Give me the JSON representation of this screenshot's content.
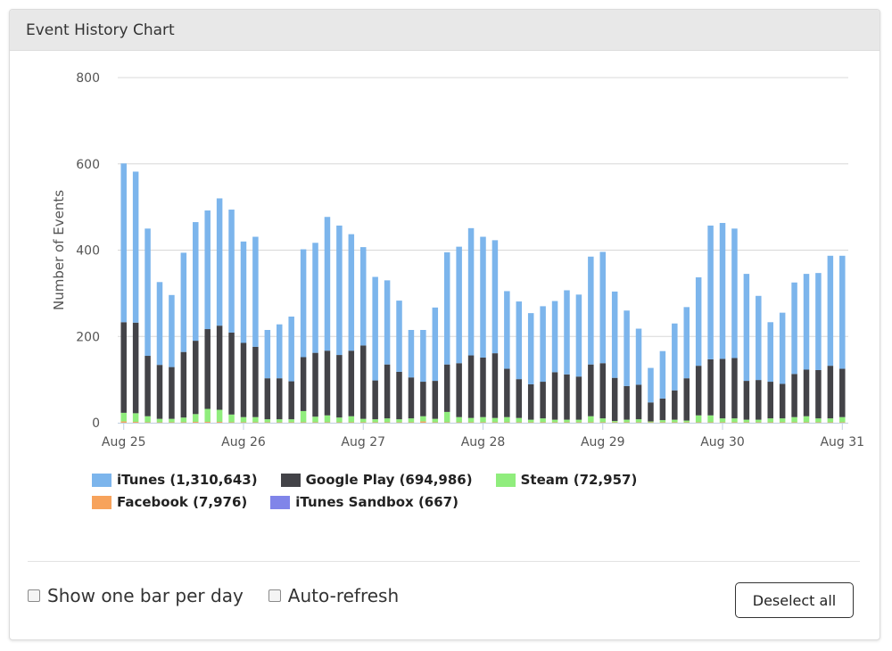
{
  "panel": {
    "title": "Event History Chart"
  },
  "chart_data": {
    "type": "bar",
    "stacked": true,
    "ylabel": "Number of Events",
    "ylim": [
      0,
      800
    ],
    "yticks": [
      0,
      200,
      400,
      600,
      800
    ],
    "xticks": [
      "Aug 25",
      "Aug 26",
      "Aug 27",
      "Aug 28",
      "Aug 29",
      "Aug 30",
      "Aug 31"
    ],
    "grid": true,
    "legend_position": "bottom",
    "series": [
      {
        "name": "iTunes (1,310,643)",
        "color": "#7cb5ec",
        "values": [
          368,
          350,
          295,
          192,
          167,
          230,
          275,
          275,
          295,
          285,
          235,
          255,
          112,
          125,
          150,
          250,
          255,
          310,
          300,
          270,
          228,
          240,
          195,
          165,
          110,
          120,
          170,
          260,
          270,
          295,
          280,
          262,
          180,
          180,
          165,
          175,
          165,
          195,
          190,
          250,
          258,
          200,
          175,
          130,
          80,
          110,
          155,
          165,
          205,
          310,
          315,
          300,
          248,
          195,
          138,
          165,
          212,
          222,
          225,
          255,
          262
        ],
        "hidden_layout_note": null
      },
      {
        "name": "Google Play (694,986)",
        "color": "#434348",
        "values": [
          210,
          210,
          140,
          125,
          120,
          152,
          170,
          185,
          195,
          190,
          172,
          163,
          95,
          95,
          88,
          125,
          148,
          150,
          145,
          152,
          170,
          90,
          125,
          110,
          95,
          80,
          88,
          110,
          125,
          145,
          138,
          150,
          112,
          90,
          82,
          85,
          110,
          105,
          100,
          120,
          128,
          100,
          78,
          80,
          44,
          50,
          68,
          98,
          115,
          130,
          138,
          140,
          90,
          92,
          85,
          80,
          100,
          108,
          112,
          122,
          112
        ]
      },
      {
        "name": "Steam (72,957)",
        "color": "#90ed7d",
        "values": [
          20,
          20,
          14,
          8,
          8,
          11,
          18,
          30,
          28,
          18,
          12,
          12,
          7,
          7,
          7,
          26,
          13,
          16,
          11,
          14,
          8,
          7,
          9,
          7,
          9,
          12,
          8,
          24,
          12,
          10,
          12,
          10,
          12,
          10,
          6,
          9,
          6,
          6,
          6,
          14,
          9,
          3,
          6,
          7,
          2,
          5,
          6,
          4,
          16,
          16,
          9,
          9,
          6,
          6,
          9,
          9,
          12,
          14,
          9,
          9,
          12
        ]
      },
      {
        "name": "Facebook (7,976)",
        "color": "#f7a35c",
        "values": [
          3,
          2,
          1,
          1,
          1,
          1,
          2,
          2,
          2,
          1,
          1,
          1,
          1,
          1,
          1,
          1,
          1,
          1,
          1,
          1,
          1,
          1,
          1,
          1,
          1,
          3,
          1,
          1,
          1,
          1,
          1,
          1,
          1,
          1,
          1,
          1,
          1,
          1,
          1,
          1,
          1,
          1,
          1,
          1,
          1,
          1,
          1,
          1,
          1,
          1,
          1,
          1,
          1,
          1,
          1,
          1,
          1,
          1,
          1,
          1,
          1
        ]
      },
      {
        "name": "iTunes Sandbox (667)",
        "color": "#8085e9",
        "values": [
          0,
          0,
          0,
          0,
          0,
          0,
          0,
          0,
          0,
          0,
          0,
          0,
          0,
          0,
          0,
          0,
          0,
          0,
          0,
          0,
          0,
          0,
          0,
          0,
          0,
          0,
          0,
          0,
          0,
          0,
          0,
          0,
          0,
          0,
          0,
          0,
          0,
          0,
          0,
          0,
          0,
          0,
          0,
          0,
          0,
          0,
          0,
          0,
          0,
          0,
          0,
          0,
          0,
          0,
          0,
          0,
          0,
          0,
          0,
          0,
          0
        ]
      }
    ]
  },
  "controls": {
    "show_one_bar": "Show one bar per day",
    "auto_refresh": "Auto-refresh",
    "deselect_all": "Deselect all"
  }
}
